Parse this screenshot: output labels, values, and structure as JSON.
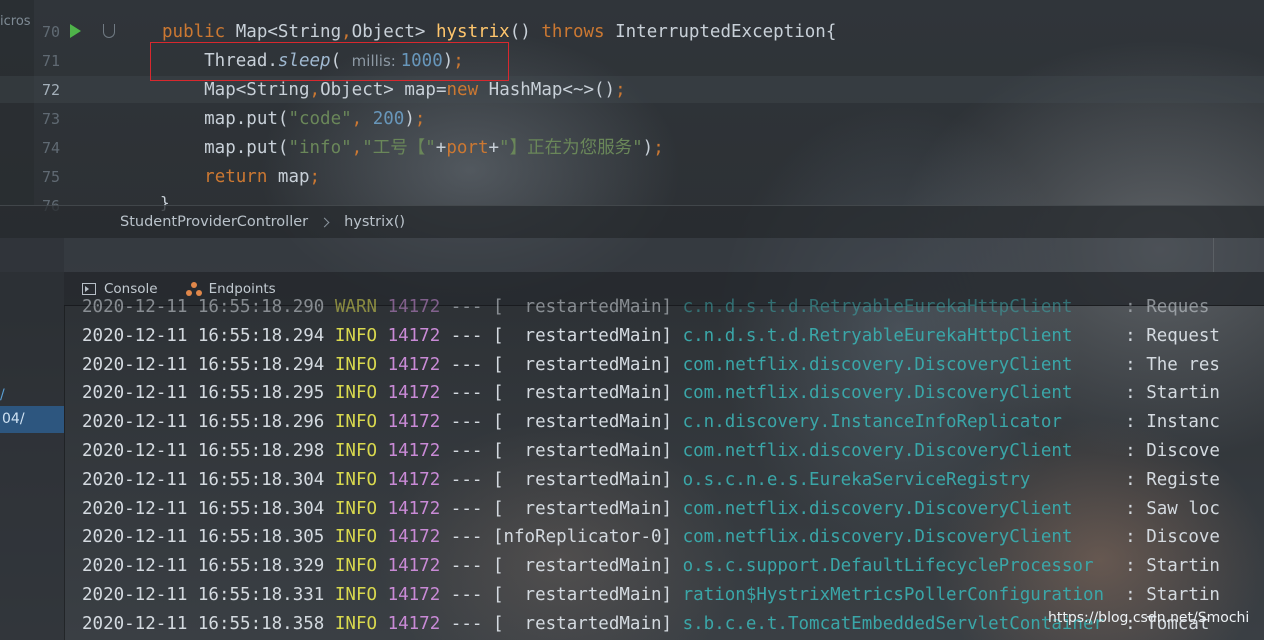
{
  "editor": {
    "left_cut_text": "icros",
    "line_numbers": [
      "70",
      "71",
      "72",
      "73",
      "74",
      "75",
      "76"
    ],
    "active_line": "72",
    "lines": [
      {
        "parts": [
          [
            "kw",
            "public "
          ],
          [
            "t",
            "Map<String"
          ],
          [
            "kw",
            ","
          ],
          [
            "t",
            "Object> "
          ],
          [
            "fn",
            "hystrix"
          ],
          [
            "t",
            "() "
          ],
          [
            "kw",
            "throws "
          ],
          [
            "t",
            "InterruptedException{"
          ]
        ]
      },
      {
        "parts": [
          [
            "t",
            "    Thread."
          ],
          [
            "it",
            "sleep"
          ],
          [
            "t",
            "( "
          ],
          [
            "hint",
            "millis: "
          ],
          [
            "num",
            "1000"
          ],
          [
            "t",
            ")"
          ],
          [
            "kw",
            ";"
          ]
        ]
      },
      {
        "parts": [
          [
            "t",
            "    Map<String"
          ],
          [
            "kw",
            ","
          ],
          [
            "t",
            "Object> map="
          ],
          [
            "kw",
            "new "
          ],
          [
            "t",
            "HashMap<~>()"
          ],
          [
            "kw",
            ";"
          ]
        ]
      },
      {
        "parts": [
          [
            "t",
            "    map.put("
          ],
          [
            "str",
            "\"code\""
          ],
          [
            "kw",
            ", "
          ],
          [
            "num",
            "200"
          ],
          [
            "t",
            ")"
          ],
          [
            "kw",
            ";"
          ]
        ]
      },
      {
        "parts": [
          [
            "t",
            "    map.put("
          ],
          [
            "str",
            "\"info\""
          ],
          [
            "kw",
            ","
          ],
          [
            "str",
            "\""
          ],
          [
            "cn",
            "工号【"
          ],
          [
            "str",
            "\""
          ],
          [
            "t",
            "+"
          ],
          [
            "kw",
            "port"
          ],
          [
            "t",
            "+"
          ],
          [
            "str",
            "\""
          ],
          [
            "cn",
            "】正在为您服务"
          ],
          [
            "str",
            "\""
          ],
          [
            "t",
            ")"
          ],
          [
            "kw",
            ";"
          ]
        ]
      },
      {
        "parts": [
          [
            "t",
            "    "
          ],
          [
            "kw",
            "return "
          ],
          [
            "t",
            "map"
          ],
          [
            "kw",
            ";"
          ]
        ]
      }
    ],
    "cut_line": "}"
  },
  "breadcrumb": {
    "class_name": "StudentProviderController",
    "method_name": "hystrix()"
  },
  "tabs": {
    "console_label": "Console",
    "endpoints_label": "Endpoints"
  },
  "side": {
    "item_slash": "/",
    "item_selected": "04/"
  },
  "console": {
    "lines": [
      {
        "ts": "2020-12-11 16:55:18.290",
        "level": "WARN",
        "pid": "14172",
        "sep": " --- [",
        "thread": "  restartedMain]",
        "logger": "c.n.d.s.t.d.RetryableEurekaHttpClient    ",
        "msg": " : Reques",
        "dim": true
      },
      {
        "ts": "2020-12-11 16:55:18.294",
        "level": "INFO",
        "pid": "14172",
        "sep": " --- [",
        "thread": "  restartedMain]",
        "logger": "c.n.d.s.t.d.RetryableEurekaHttpClient    ",
        "msg": " : Request"
      },
      {
        "ts": "2020-12-11 16:55:18.294",
        "level": "INFO",
        "pid": "14172",
        "sep": " --- [",
        "thread": "  restartedMain]",
        "logger": "com.netflix.discovery.DiscoveryClient    ",
        "msg": " : The res"
      },
      {
        "ts": "2020-12-11 16:55:18.295",
        "level": "INFO",
        "pid": "14172",
        "sep": " --- [",
        "thread": "  restartedMain]",
        "logger": "com.netflix.discovery.DiscoveryClient    ",
        "msg": " : Startin"
      },
      {
        "ts": "2020-12-11 16:55:18.296",
        "level": "INFO",
        "pid": "14172",
        "sep": " --- [",
        "thread": "  restartedMain]",
        "logger": "c.n.discovery.InstanceInfoReplicator     ",
        "msg": " : Instanc"
      },
      {
        "ts": "2020-12-11 16:55:18.298",
        "level": "INFO",
        "pid": "14172",
        "sep": " --- [",
        "thread": "  restartedMain]",
        "logger": "com.netflix.discovery.DiscoveryClient    ",
        "msg": " : Discove"
      },
      {
        "ts": "2020-12-11 16:55:18.304",
        "level": "INFO",
        "pid": "14172",
        "sep": " --- [",
        "thread": "  restartedMain]",
        "logger": "o.s.c.n.e.s.EurekaServiceRegistry        ",
        "msg": " : Registe"
      },
      {
        "ts": "2020-12-11 16:55:18.304",
        "level": "INFO",
        "pid": "14172",
        "sep": " --- [",
        "thread": "  restartedMain]",
        "logger": "com.netflix.discovery.DiscoveryClient    ",
        "msg": " : Saw loc"
      },
      {
        "ts": "2020-12-11 16:55:18.305",
        "level": "INFO",
        "pid": "14172",
        "sep": " --- [",
        "thread": "nfoReplicator-0]",
        "logger": "com.netflix.discovery.DiscoveryClient    ",
        "msg": " : Discove"
      },
      {
        "ts": "2020-12-11 16:55:18.329",
        "level": "INFO",
        "pid": "14172",
        "sep": " --- [",
        "thread": "  restartedMain]",
        "logger": "o.s.c.support.DefaultLifecycleProcessor  ",
        "msg": " : Startin"
      },
      {
        "ts": "2020-12-11 16:55:18.331",
        "level": "INFO",
        "pid": "14172",
        "sep": " --- [",
        "thread": "  restartedMain]",
        "logger": "ration$HystrixMetricsPollerConfiguration ",
        "msg": " : Startin"
      },
      {
        "ts": "2020-12-11 16:55:18.358",
        "level": "INFO",
        "pid": "14172",
        "sep": " --- [",
        "thread": "  restartedMain]",
        "logger": "s.b.c.e.t.TomcatEmbeddedServletContainer ",
        "msg": " : Tomcat"
      }
    ]
  },
  "watermark": "https://blog.csdn.net/Smochi"
}
